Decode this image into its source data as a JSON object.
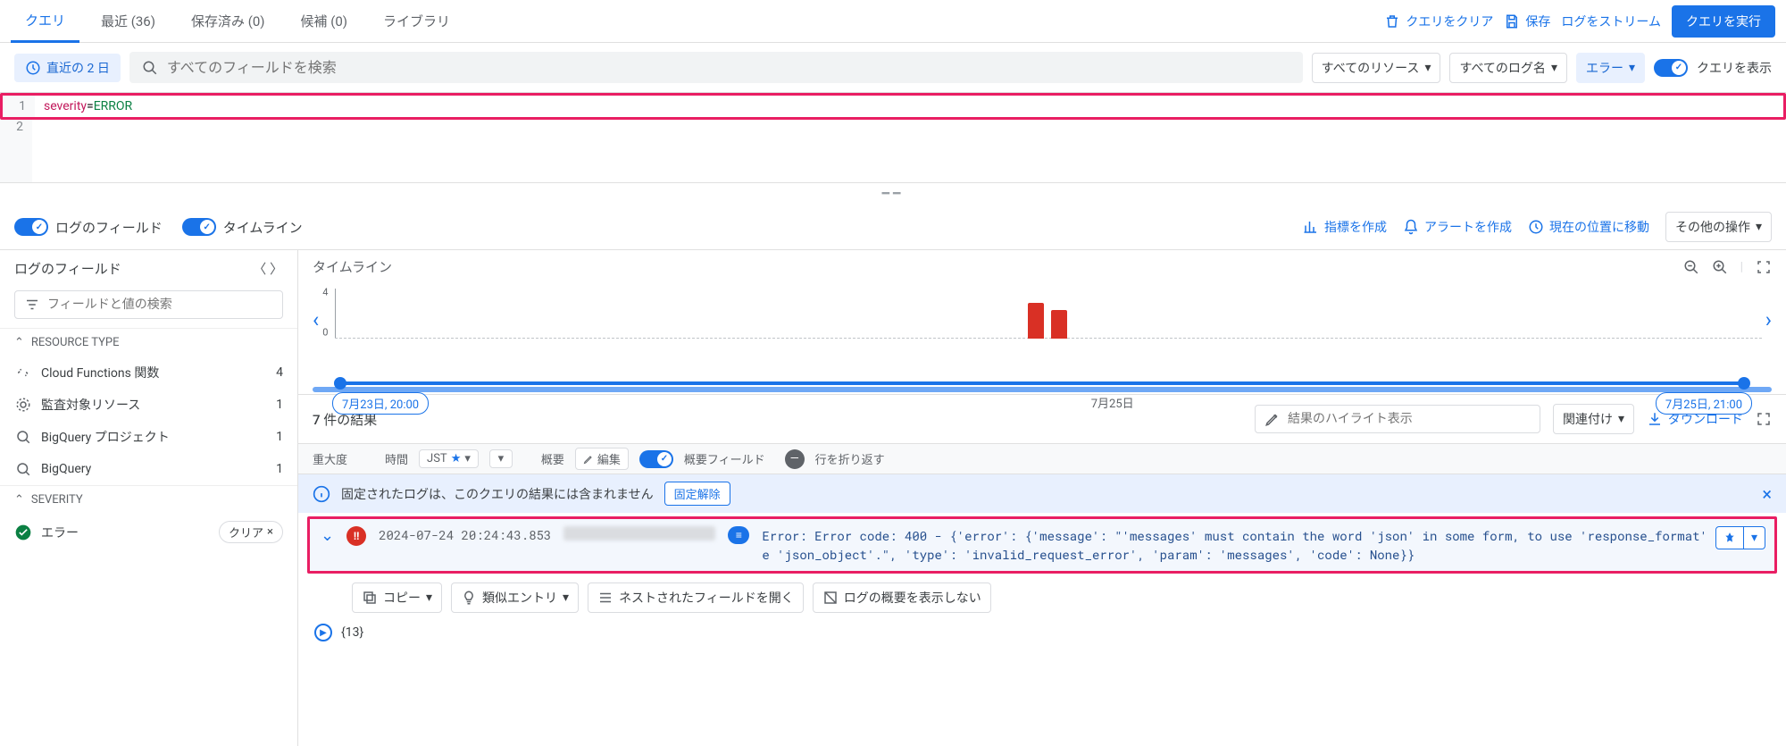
{
  "tabs": {
    "query": "クエリ",
    "recent": "最近 (36)",
    "saved": "保存済み (0)",
    "suggest": "候補 (0)",
    "library": "ライブラリ"
  },
  "topbar": {
    "clear": "クエリをクリア",
    "save": "保存",
    "stream": "ログをストリーム",
    "run": "クエリを実行"
  },
  "filter": {
    "timerange": "直近の 2 日",
    "search_ph": "すべてのフィールドを検索",
    "resource": "すべてのリソース",
    "logname": "すべてのログ名",
    "severity": "エラー",
    "showquery": "クエリを表示"
  },
  "editor": {
    "l1_key": "severity",
    "l1_val": "ERROR"
  },
  "secbar": {
    "fields": "ログのフィールド",
    "timeline": "タイムライン",
    "metric": "指標を作成",
    "alert": "アラートを作成",
    "jump": "現在の位置に移動",
    "more": "その他の操作"
  },
  "sidebar": {
    "title": "ログのフィールド",
    "search_ph": "フィールドと値の検索",
    "sec_resource": "RESOURCE TYPE",
    "items": [
      {
        "label": "Cloud Functions 関数",
        "count": "4"
      },
      {
        "label": "監査対象リソース",
        "count": "1"
      },
      {
        "label": "BigQuery プロジェクト",
        "count": "1"
      },
      {
        "label": "BigQuery",
        "count": "1"
      }
    ],
    "sec_sev": "SEVERITY",
    "sev_item": "エラー",
    "clear": "クリア"
  },
  "timeline": {
    "title": "タイムライン",
    "y_hi": "4",
    "y_lo": "0",
    "start": "7月23日, 20:00",
    "mid": "7月25日",
    "end": "7月25日, 21:00"
  },
  "results": {
    "count": "7 件の結果",
    "highlight_ph": "結果のハイライト表示",
    "correlate": "関連付け",
    "download": "ダウンロード"
  },
  "cols": {
    "severity": "重大度",
    "time": "時間",
    "tz": "JST",
    "summary": "概要",
    "edit": "編集",
    "sumfields": "概要フィールド",
    "wrap": "行を折り返す"
  },
  "banner": {
    "text": "固定されたログは、このクエリの結果には含まれません",
    "unpin": "固定解除"
  },
  "log": {
    "ts": "2024-07-24 20:24:43.853",
    "msg": "Error: Error code: 400 - {'error': {'message': \"'messages' must contain the word 'json' in some form, to use 'response_format' of type 'json_object'.\", 'type': 'invalid_request_error', 'param': 'messages', 'code': None}}"
  },
  "actions": {
    "copy": "コピー",
    "similar": "類似エントリ",
    "nested": "ネストされたフィールドを開く",
    "nosummary": "ログの概要を表示しない"
  },
  "expand": "{13}"
}
